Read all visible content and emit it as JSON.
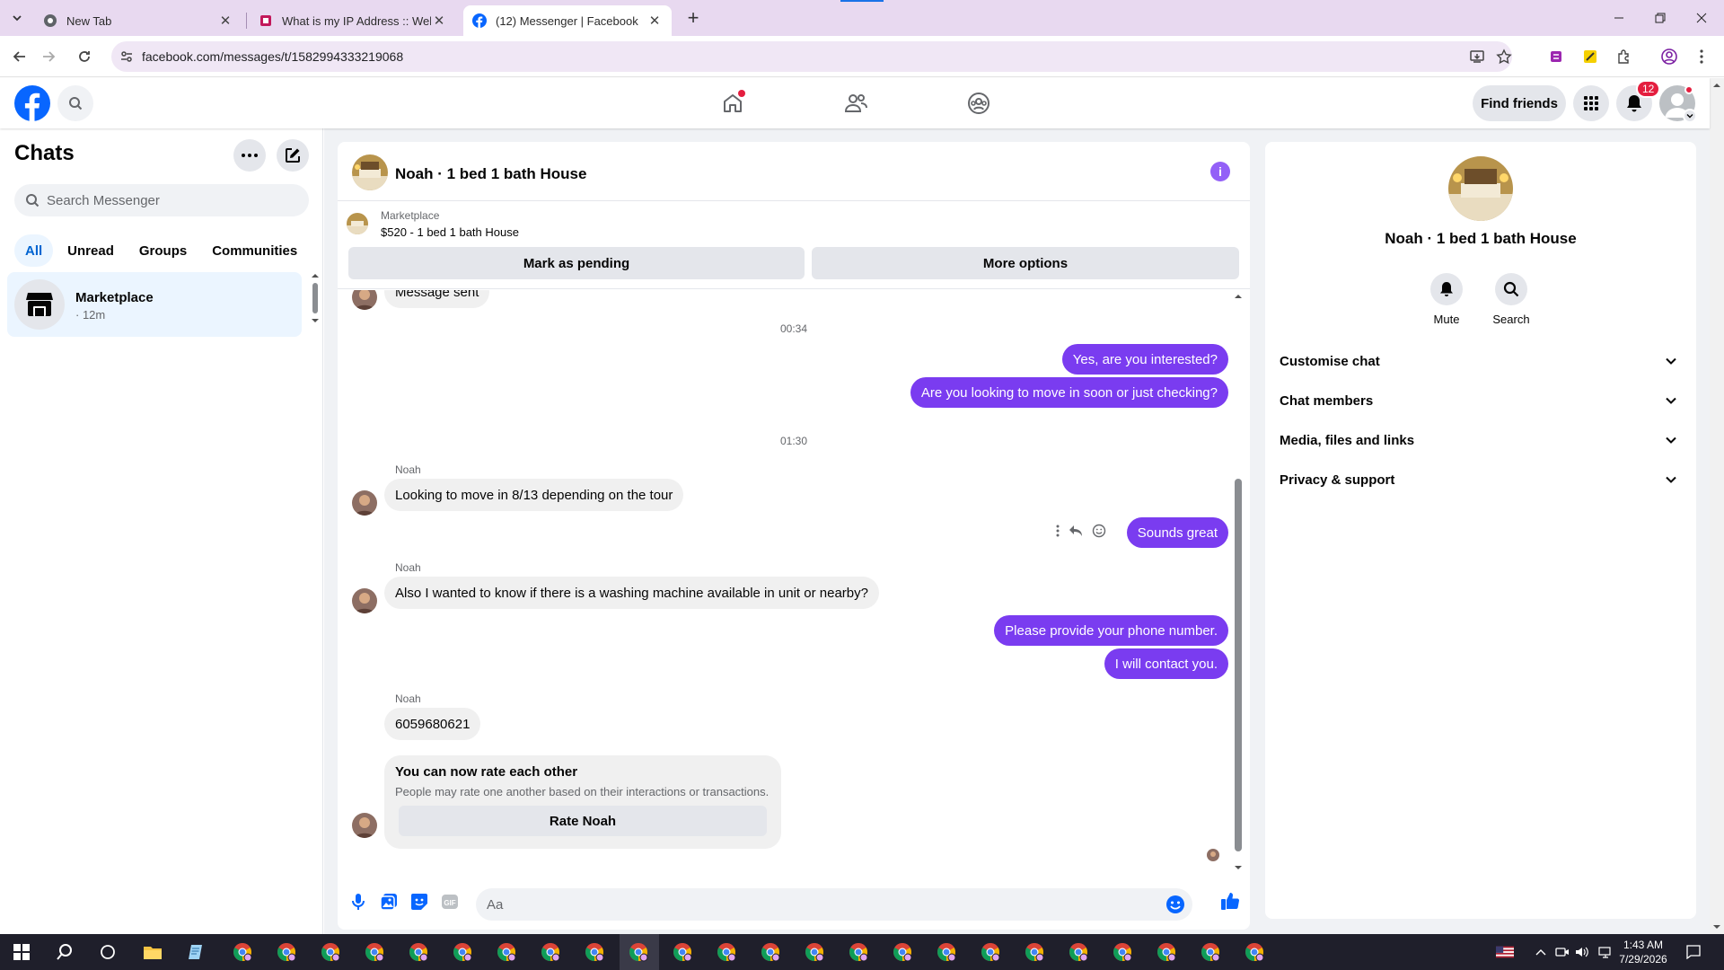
{
  "browser": {
    "tabs": [
      {
        "title": "New Tab"
      },
      {
        "title": "What is my IP Address :: WebBr"
      },
      {
        "title": "(12) Messenger | Facebook"
      }
    ],
    "url": "facebook.com/messages/t/1582994333219068"
  },
  "fb_header": {
    "find_friends": "Find friends",
    "notifications_count": "12"
  },
  "chats": {
    "title": "Chats",
    "search_placeholder": "Search Messenger",
    "filters": [
      "All",
      "Unread",
      "Groups",
      "Communities"
    ],
    "items": [
      {
        "name": "Marketplace",
        "time": "· 12m"
      }
    ]
  },
  "conversation": {
    "title": "Noah · 1 bed 1 bath House",
    "marketplace_label": "Marketplace",
    "listing": "$520 - 1 bed 1 bath House",
    "mark_pending": "Mark as pending",
    "more_options": "More options",
    "partial_msg": "Message sent",
    "time1": "00:34",
    "out1": "Yes, are you interested?",
    "out2": "Are you looking to move in soon or just checking?",
    "time2": "01:30",
    "sender": "Noah",
    "in1": "Looking to move in 8/13 depending on the tour",
    "out3": "Sounds great",
    "in2": "Also I wanted to know if there is a washing machine available in unit or nearby?",
    "out4": "Please provide your phone number.",
    "out5": "I will contact you.",
    "in3": "6059680621",
    "rate_title": "You can now rate each other",
    "rate_sub": "People may rate one another based on their interactions or transactions.",
    "rate_btn": "Rate Noah",
    "composer_placeholder": "Aa"
  },
  "info_panel": {
    "name": "Noah · 1 bed 1 bath House",
    "mute": "Mute",
    "search": "Search",
    "rows": [
      "Customise chat",
      "Chat members",
      "Media, files and links",
      "Privacy & support"
    ]
  },
  "taskbar": {
    "time": "1:43 AM",
    "date": "7/29/2026"
  },
  "colors": {
    "fb_blue": "#0866ff",
    "outgoing_bubble": "#7a3cf0",
    "incoming_bubble": "#f0f0f0",
    "badge_red": "#e41e3f"
  }
}
